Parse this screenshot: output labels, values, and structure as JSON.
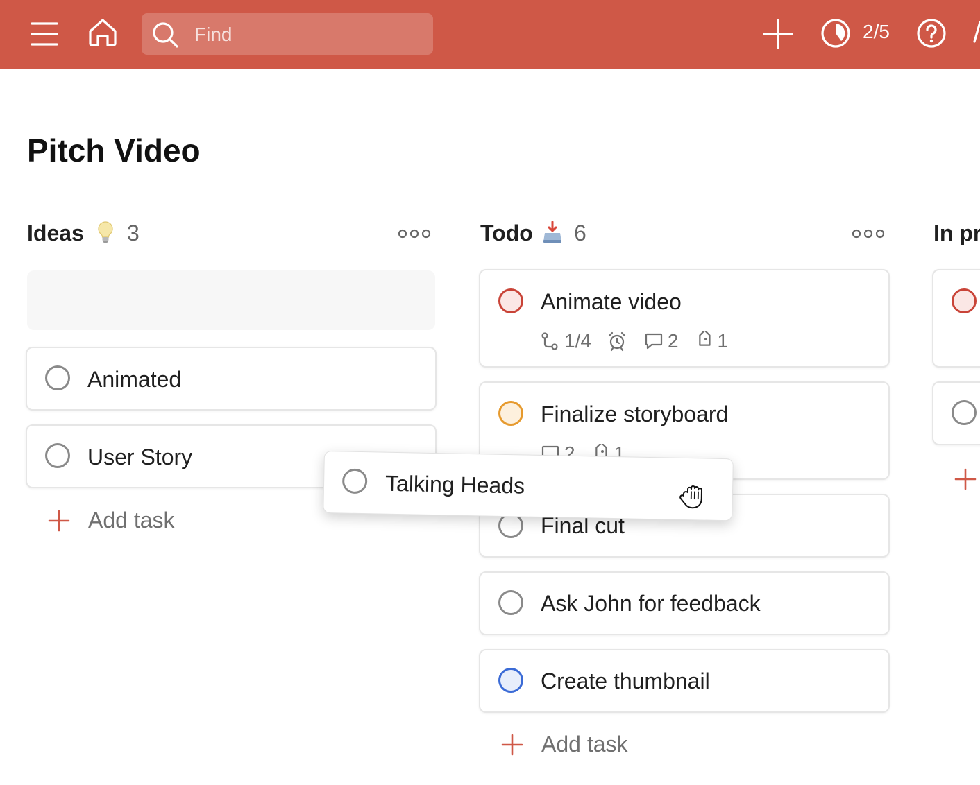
{
  "topbar": {
    "search_placeholder": "Find",
    "karma": "2/5",
    "bg_color": "#cf5847"
  },
  "page": {
    "title": "Pitch Video"
  },
  "columns": [
    {
      "name": "Ideas",
      "emoji": "💡",
      "count": "3",
      "tasks": [
        {
          "title": "Animated",
          "priority": "none"
        },
        {
          "title": "User Story",
          "priority": "none"
        }
      ],
      "add_task": "Add task"
    },
    {
      "name": "Todo",
      "emoji": "📥",
      "count": "6",
      "tasks": [
        {
          "title": "Animate video",
          "priority": "p1",
          "subtasks": "1/4",
          "reminder": true,
          "comments": "2",
          "labels": "1"
        },
        {
          "title": "Finalize storyboard",
          "priority": "p2",
          "comments": "2",
          "labels": "1"
        },
        {
          "title": "Final cut",
          "priority": "none"
        },
        {
          "title": "Ask John for feedback",
          "priority": "none"
        },
        {
          "title": "Create thumbnail",
          "priority": "p3"
        }
      ],
      "add_task": "Add task"
    },
    {
      "name": "In pr",
      "tasks": [
        {
          "priority": "p1"
        },
        {
          "priority": "none"
        }
      ]
    }
  ],
  "dragging_task": {
    "title": "Talking Heads",
    "cursor": "grab-hand-icon"
  },
  "priority_colors": {
    "p1": "#c94438",
    "p2": "#e69a2e",
    "p3": "#3b6bd6",
    "none": "#8a8a8a"
  }
}
